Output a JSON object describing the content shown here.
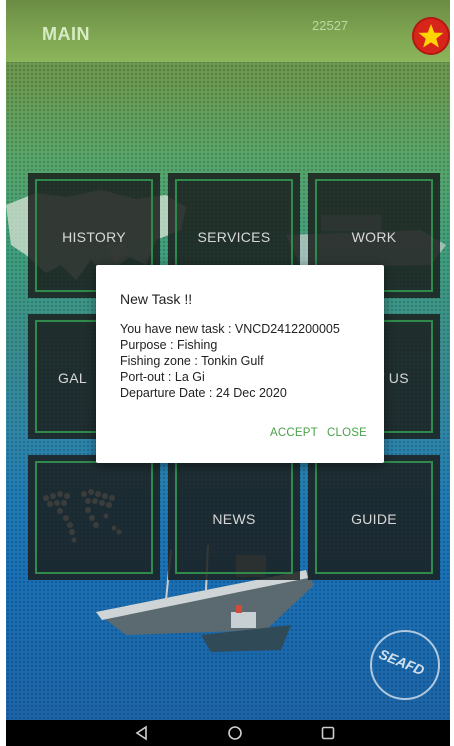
{
  "header": {
    "title": "MAIN",
    "code": "22527",
    "flag_icon": "vietnam-flag-icon",
    "flag_color": "#d8251c"
  },
  "tiles": [
    {
      "label": "HISTORY"
    },
    {
      "label": "SERVICES"
    },
    {
      "label": "WORK"
    },
    {
      "label": "GAL"
    },
    {
      "label": "T US"
    },
    {
      "label": ""
    },
    {
      "label": "NEWS"
    },
    {
      "label": "GUIDE"
    }
  ],
  "dialog": {
    "title": "New Task !!",
    "lines": [
      "You have new task : VNCD2412200005",
      "Purpose : Fishing",
      "Fishing zone : Tonkin Gulf",
      "Port-out : La Gi",
      "Departure Date : 24 Dec 2020"
    ],
    "accept_label": "ACCEPT",
    "close_label": "CLOSE",
    "button_color": "#4aa14a"
  },
  "navbar": {
    "back_icon": "back-triangle-icon",
    "home_icon": "home-circle-icon",
    "recents_icon": "recents-square-icon"
  }
}
